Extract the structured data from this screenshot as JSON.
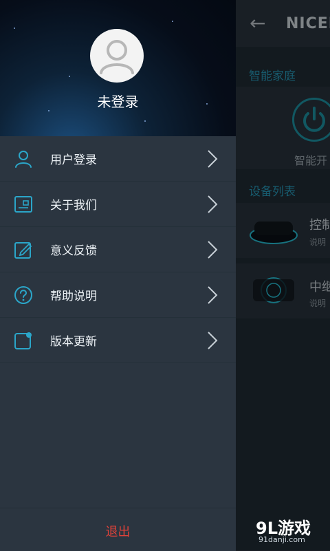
{
  "background_app": {
    "title": "NICEL",
    "section_smart_home": "智能家庭",
    "power_label": "智能开",
    "section_devices": "设备列表",
    "devices": [
      {
        "title": "控制",
        "subtitle": "说明"
      },
      {
        "title": "中继",
        "subtitle": "说明"
      }
    ]
  },
  "drawer": {
    "username": "未登录",
    "menu": [
      {
        "label": "用户登录",
        "icon": "user-icon"
      },
      {
        "label": "关于我们",
        "icon": "about-icon"
      },
      {
        "label": "意义反馈",
        "icon": "feedback-icon"
      },
      {
        "label": "帮助说明",
        "icon": "help-icon"
      },
      {
        "label": "版本更新",
        "icon": "update-icon"
      }
    ],
    "logout": "退出"
  },
  "watermark": {
    "brand": "9L游戏",
    "site": "91danji.com"
  },
  "colors": {
    "accent": "#2ba6c9",
    "logout": "#e0423a",
    "drawer_bg": "#2b3540"
  }
}
